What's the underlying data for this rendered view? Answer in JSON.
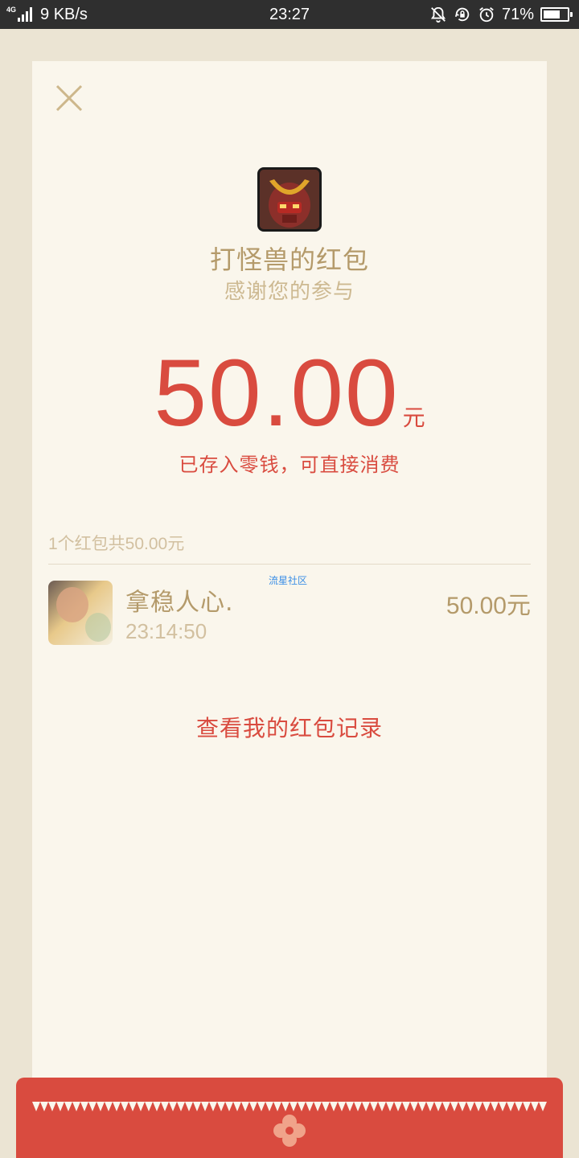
{
  "status_bar": {
    "network": "4G",
    "speed": "9 KB/s",
    "time": "23:27",
    "battery_percent_text": "71%",
    "battery_level": 0.71
  },
  "icons": {
    "close": "close-icon",
    "mute": "bell-off-icon",
    "rotation_lock": "rotation-lock-icon",
    "alarm": "alarm-icon"
  },
  "envelope": {
    "title": "打怪兽的红包",
    "subtitle": "感谢您的参与",
    "amount": "50.00",
    "amount_unit": "元",
    "note": "已存入零钱，可直接消费",
    "summary": "1个红包共50.00元",
    "link": "查看我的红包记录"
  },
  "recipients": [
    {
      "name": "拿稳人心.",
      "time": "23:14:50",
      "amount": "50.00元"
    }
  ],
  "watermark": "流星社区",
  "colors": {
    "accent_red": "#d94b3f",
    "gold": "#b49a6a",
    "light_gold": "#d2c0a0",
    "card_bg": "#faf6ec",
    "page_bg": "#ebe4d3"
  }
}
